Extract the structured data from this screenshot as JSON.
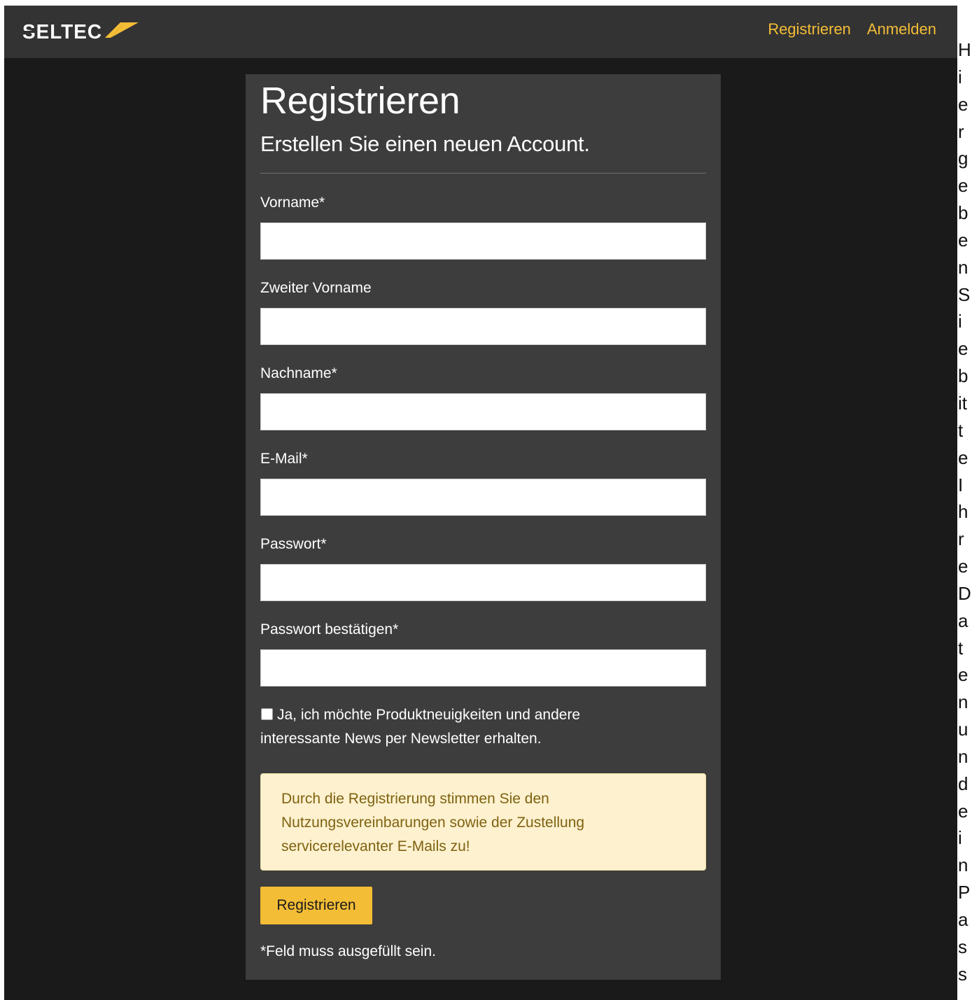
{
  "brand": {
    "logo_text": "SELTEC",
    "accent_color": "#f4bd36",
    "navbar_color": "#333333",
    "background_color": "#1a1a1a",
    "card_color": "#3d3d3d"
  },
  "nav": {
    "register_label": "Registrieren",
    "login_label": "Anmelden"
  },
  "form": {
    "title": "Registrieren",
    "subtitle": "Erstellen Sie einen neuen Account.",
    "fields": [
      {
        "label": "Vorname*",
        "value": "",
        "placeholder": ""
      },
      {
        "label": "Zweiter Vorname",
        "value": "",
        "placeholder": ""
      },
      {
        "label": "Nachname*",
        "value": "",
        "placeholder": ""
      },
      {
        "label": "E-Mail*",
        "value": "",
        "placeholder": ""
      },
      {
        "label": "Passwort*",
        "value": "",
        "placeholder": ""
      },
      {
        "label": "Passwort bestätigen*",
        "value": "",
        "placeholder": ""
      }
    ],
    "newsletter": {
      "checked": false,
      "label": "Ja, ich möchte Produktneuigkeiten und andere interessante News per Newsletter erhalten."
    },
    "notice_line1": "Durch die Registrierung stimmen Sie den",
    "notice_line2": "Nutzungsvereinbarungen sowie der Zustellung",
    "notice_line3": "servicerelevanter E-Mails zu!",
    "submit_label": "Registrieren",
    "required_note": "*Feld muss ausgefüllt sein."
  },
  "side_text": "HiergebenSiebitteIhreDatenundeinPass"
}
